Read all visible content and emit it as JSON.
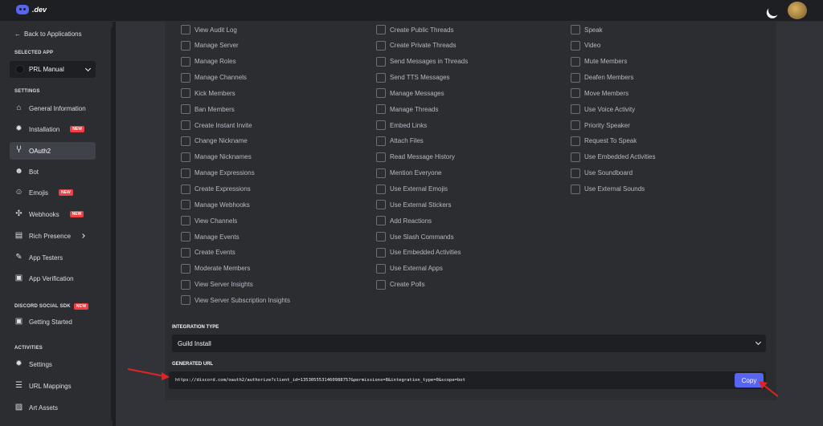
{
  "topbar": {
    "logo_text": ".dev"
  },
  "sidebar": {
    "back": "Back to Applications",
    "selected_app_label": "SELECTED APP",
    "selected_app": "PRL Manual",
    "settings_label": "SETTINGS",
    "items": [
      {
        "label": "General Information",
        "icon": "home-icon"
      },
      {
        "label": "Installation",
        "icon": "gear-icon",
        "badge": "NEW"
      },
      {
        "label": "OAuth2",
        "icon": "wrench-icon",
        "active": true
      },
      {
        "label": "Bot",
        "icon": "bot-icon"
      },
      {
        "label": "Emojis",
        "icon": "smile-icon",
        "badge": "NEW"
      },
      {
        "label": "Webhooks",
        "icon": "webhook-icon",
        "badge": "NEW"
      },
      {
        "label": "Rich Presence",
        "icon": "presence-icon"
      },
      {
        "label": "App Testers",
        "icon": "testers-icon"
      },
      {
        "label": "App Verification",
        "icon": "verified-icon"
      }
    ],
    "social_sdk_label": "DISCORD SOCIAL SDK",
    "social_sdk_badge": "NEW",
    "getting_started": "Getting Started",
    "activities_label": "ACTIVITIES",
    "activities": [
      {
        "label": "Settings",
        "icon": "gear-icon"
      },
      {
        "label": "URL Mappings",
        "icon": "list-icon"
      },
      {
        "label": "Art Assets",
        "icon": "image-icon"
      }
    ]
  },
  "permissions": {
    "col1": [
      "View Audit Log",
      "Manage Server",
      "Manage Roles",
      "Manage Channels",
      "Kick Members",
      "Ban Members",
      "Create Instant Invite",
      "Change Nickname",
      "Manage Nicknames",
      "Manage Expressions",
      "Create Expressions",
      "Manage Webhooks",
      "View Channels",
      "Manage Events",
      "Create Events",
      "Moderate Members",
      "View Server Insights",
      "View Server Subscription Insights"
    ],
    "col2": [
      "Create Public Threads",
      "Create Private Threads",
      "Send Messages in Threads",
      "Send TTS Messages",
      "Manage Messages",
      "Manage Threads",
      "Embed Links",
      "Attach Files",
      "Read Message History",
      "Mention Everyone",
      "Use External Emojis",
      "Use External Stickers",
      "Add Reactions",
      "Use Slash Commands",
      "Use Embedded Activities",
      "Use External Apps",
      "Create Polls"
    ],
    "col3": [
      "Speak",
      "Video",
      "Mute Members",
      "Deafen Members",
      "Move Members",
      "Use Voice Activity",
      "Priority Speaker",
      "Request To Speak",
      "Use Embedded Activities",
      "Use Soundboard",
      "Use External Sounds"
    ]
  },
  "integration": {
    "label": "INTEGRATION TYPE",
    "value": "Guild Install"
  },
  "generated": {
    "label": "GENERATED URL",
    "url": "https://discord.com/oauth2/authorize?client_id=1353055531460988757&permissions=8&integration_type=0&scope=bot",
    "copy_label": "Copy"
  },
  "colors": {
    "accent": "#5865f2",
    "badge": "#f23f43",
    "annotation_arrow": "#e02424"
  }
}
